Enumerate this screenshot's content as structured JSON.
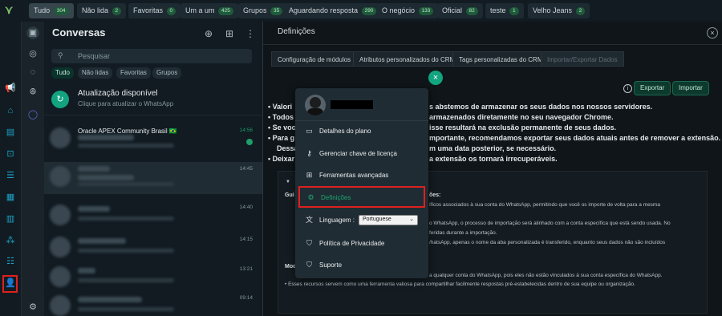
{
  "tabs": [
    {
      "label": "Tudo",
      "count": "304",
      "active": true
    },
    {
      "label": "Não lida",
      "count": "2"
    },
    {
      "label": "Favoritas",
      "count": "0"
    },
    {
      "label": "Um a um",
      "count": "425"
    },
    {
      "label": "Grupos",
      "count": "35"
    },
    {
      "label": "Aguardando resposta",
      "count": "290"
    },
    {
      "label": "O negócio",
      "count": "133"
    },
    {
      "label": "Oficial",
      "count": "82"
    },
    {
      "label": "teste",
      "count": "1"
    },
    {
      "label": "Velho Jeans",
      "count": "2"
    }
  ],
  "chats": {
    "title": "Conversas",
    "search_placeholder": "Pesquisar",
    "filters": [
      "Tudo",
      "Não lidas",
      "Favoritas",
      "Grupos"
    ],
    "update_title": "Atualização disponível",
    "update_subtitle": "Clique para atualizar o WhatsApp",
    "items": [
      {
        "name": "Oracle APEX Community Brasil 🇧🇷",
        "time": "14:56",
        "unread": true
      },
      {
        "name": "",
        "time": "14:45",
        "selected": true
      },
      {
        "name": "",
        "time": "14:40"
      },
      {
        "name": "",
        "time": "14:15"
      },
      {
        "name": "",
        "time": "13:21"
      },
      {
        "name": "",
        "time": "09:14"
      }
    ]
  },
  "settings": {
    "title": "Definições",
    "tabs": [
      "Configuração de módulos",
      "Atributos personalizados do CRM",
      "Tags personalizadas do CRM",
      "Importar/Exportar Dados"
    ],
    "export_label": "Exportar",
    "import_label": "Importar",
    "bullets": [
      "Valori",
      "Todos",
      "Se voc",
      "Para g",
      "Dessa",
      "Deixar"
    ],
    "bullets_right": [
      "s abstemos de armazenar os seus dados nos nossos servidores.",
      "armazenados diretamente no seu navegador Chrome.",
      "isse resultará na exclusão permanente de seus dados.",
      "mportante, recomendamos exportar seus dados atuais antes de remover a extensão.",
      "m uma data posterior, se necessário.",
      "a extensão os tornará irrecuperáveis."
    ],
    "section_sub": "Gui",
    "section_sub_right": "ões:",
    "section_lines": [
      "íficos associados à sua conta do WhatsApp, permitindo que você os importe de volta para a mesma",
      "o WhatsApp, o processo de importação será alinhado com a conta específica que está sendo usada. No",
      "feridas durante a importação.",
      "/hatsApp, apenas o nome da aba personalizada é transferido, enquanto seus dados não são incluídos",
      "a qualquer conta do WhatsApp, pois eles não estão vinculados à sua conta específica do WhatsApp.",
      "Esses recursos servem como uma ferramenta valiosa para compartilhar facilmente respostas pré-estabelecidas dentro de sua equipe ou organização."
    ],
    "section_mod": "Mod"
  },
  "menu": {
    "items": [
      {
        "label": "Detalhes do plano",
        "icon": "plan-icon"
      },
      {
        "label": "Gerenciar chave de licença",
        "icon": "key-icon"
      },
      {
        "label": "Ferramentas avançadas",
        "icon": "tools-icon"
      },
      {
        "label": "Definições",
        "icon": "gear-icon"
      },
      {
        "label": "Linguagem :",
        "icon": "language-icon"
      },
      {
        "label": "Política de Privacidade",
        "icon": "shield-icon"
      },
      {
        "label": "Suporte",
        "icon": "support-icon"
      }
    ],
    "language_value": "Portuguese"
  },
  "colors": {
    "accent": "#12a37f",
    "highlight": "#e0201f",
    "rail_icon": "#1ea0c8"
  }
}
